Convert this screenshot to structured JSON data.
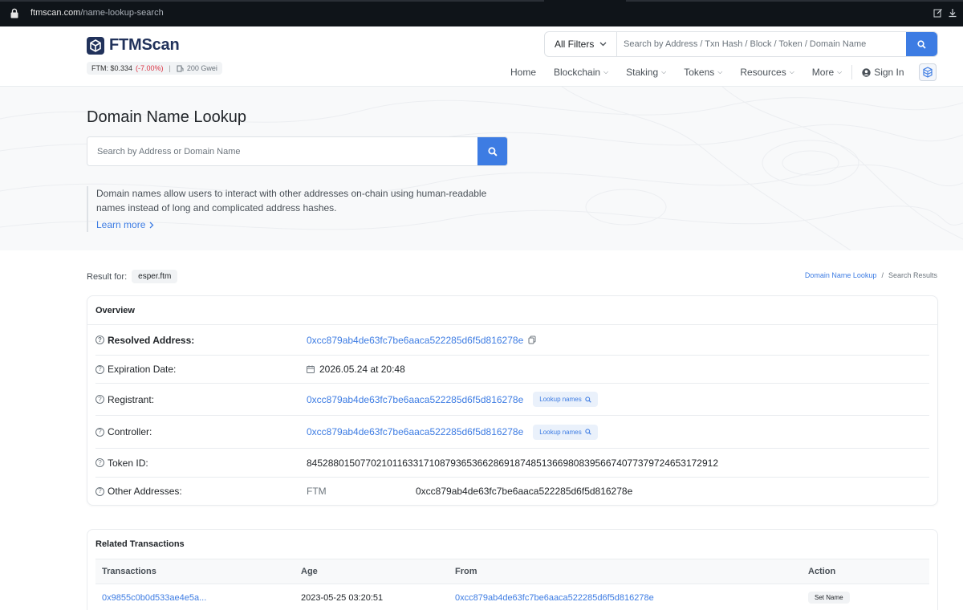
{
  "browser": {
    "url_host": "ftmscan.com",
    "url_path": "/name-lookup-search"
  },
  "header": {
    "logo_text": "FTMScan",
    "price_label": "FTM: $0.334",
    "price_change": "(-7.00%)",
    "price_sep": "|",
    "gas": "200 Gwei",
    "filter_label": "All Filters",
    "search_placeholder": "Search by Address / Txn Hash / Block / Token / Domain Name",
    "nav": {
      "home": "Home",
      "blockchain": "Blockchain",
      "staking": "Staking",
      "tokens": "Tokens",
      "resources": "Resources",
      "more": "More",
      "signin": "Sign In"
    }
  },
  "hero": {
    "title": "Domain Name Lookup",
    "search_placeholder": "Search by Address or Domain Name",
    "info_text": "Domain names allow users to interact with other addresses on-chain using human-readable names instead of long and complicated address hashes.",
    "learn_more": "Learn more"
  },
  "result": {
    "label": "Result for:",
    "query": "esper.ftm",
    "breadcrumb": [
      "Domain Name Lookup",
      "/",
      "Search Results"
    ]
  },
  "overview": {
    "title": "Overview",
    "resolved_label": "Resolved Address:",
    "resolved_value": "0xcc879ab4de63fc7be6aaca522285d6f5d816278e",
    "expiration_label": "Expiration Date:",
    "expiration_value": "2026.05.24 at 20:48",
    "registrant_label": "Registrant:",
    "registrant_value": "0xcc879ab4de63fc7be6aaca522285d6f5d816278e",
    "controller_label": "Controller:",
    "controller_value": "0xcc879ab4de63fc7be6aaca522285d6f5d816278e",
    "lookup_label": "Lookup names",
    "tokenid_label": "Token ID:",
    "tokenid_value": "84528801507702101163317108793653662869187485136698083956674077379724653172912",
    "other_label": "Other Addresses:",
    "other_chain": "FTM",
    "other_value": "0xcc879ab4de63fc7be6aaca522285d6f5d816278e"
  },
  "related": {
    "title": "Related Transactions",
    "columns": [
      "Transactions",
      "Age",
      "From",
      "Action"
    ],
    "rows": [
      {
        "tx": "0x9855c0b0d533ae4e5a...",
        "age": "2023-05-25 03:20:51",
        "from": "0xcc879ab4de63fc7be6aaca522285d6f5d816278e",
        "action": "Set Name"
      }
    ]
  },
  "colors": {
    "accent": "#3d7ce3",
    "brand": "#21325b",
    "negative": "#dc3545"
  }
}
